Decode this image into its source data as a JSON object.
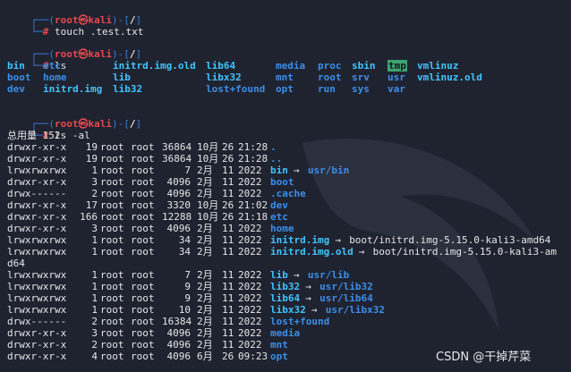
{
  "prompt": {
    "top": "┌──(",
    "user": "root",
    "at": "㉿",
    "host": "kali",
    "mid": ")-[",
    "path": "/",
    "end": "]",
    "bottom": "└─",
    "hash": "# "
  },
  "commands": {
    "cmd1": "touch .test.txt",
    "cmd2": "ls",
    "cmd3": "ls -al"
  },
  "ls_rows": [
    [
      "bin",
      "etc",
      "initrd.img.old",
      "lib64",
      "media",
      "proc",
      "sbin",
      "tmp",
      "vmlinuz"
    ],
    [
      "boot",
      "home",
      "lib",
      "libx32",
      "mnt",
      "root",
      "srv",
      "usr",
      "vmlinuz.old"
    ],
    [
      "dev",
      "initrd.img",
      "lib32",
      "lost+found",
      "opt",
      "run",
      "sys",
      "var",
      ""
    ]
  ],
  "total_line": "总用量 152",
  "listing": [
    {
      "perm": "drwxr-xr-x",
      "links": "19",
      "user": "root",
      "group": "root",
      "size": "36864",
      "month": "10月",
      "day": "26",
      "time": "21:28",
      "name": ".",
      "target": ""
    },
    {
      "perm": "drwxr-xr-x",
      "links": "19",
      "user": "root",
      "group": "root",
      "size": "36864",
      "month": "10月",
      "day": "26",
      "time": "21:28",
      "name": "..",
      "target": ""
    },
    {
      "perm": "lrwxrwxrwx",
      "links": "1",
      "user": "root",
      "group": "root",
      "size": "7",
      "month": "2月",
      "day": "11",
      "time": "2022",
      "name": "bin",
      "target": "usr/bin"
    },
    {
      "perm": "drwxr-xr-x",
      "links": "3",
      "user": "root",
      "group": "root",
      "size": "4096",
      "month": "2月",
      "day": "11",
      "time": "2022",
      "name": "boot",
      "target": ""
    },
    {
      "perm": "drwx------",
      "links": "2",
      "user": "root",
      "group": "root",
      "size": "4096",
      "month": "2月",
      "day": "11",
      "time": "2022",
      "name": ".cache",
      "target": ""
    },
    {
      "perm": "drwxr-xr-x",
      "links": "17",
      "user": "root",
      "group": "root",
      "size": "3320",
      "month": "10月",
      "day": "26",
      "time": "21:02",
      "name": "dev",
      "target": ""
    },
    {
      "perm": "drwxr-xr-x",
      "links": "166",
      "user": "root",
      "group": "root",
      "size": "12288",
      "month": "10月",
      "day": "26",
      "time": "21:18",
      "name": "etc",
      "target": ""
    },
    {
      "perm": "drwxr-xr-x",
      "links": "3",
      "user": "root",
      "group": "root",
      "size": "4096",
      "month": "2月",
      "day": "11",
      "time": "2022",
      "name": "home",
      "target": ""
    },
    {
      "perm": "lrwxrwxrwx",
      "links": "1",
      "user": "root",
      "group": "root",
      "size": "34",
      "month": "2月",
      "day": "11",
      "time": "2022",
      "name": "initrd.img",
      "target": "boot/initrd.img-5.15.0-kali3-amd64"
    },
    {
      "perm": "lrwxrwxrwx",
      "links": "1",
      "user": "root",
      "group": "root",
      "size": "34",
      "month": "2月",
      "day": "11",
      "time": "2022",
      "name": "initrd.img.old",
      "target": "boot/initrd.img-5.15.0-kali3-am"
    },
    {
      "perm": "lrwxrwxrwx",
      "links": "1",
      "user": "root",
      "group": "root",
      "size": "7",
      "month": "2月",
      "day": "11",
      "time": "2022",
      "name": "lib",
      "target": "usr/lib"
    },
    {
      "perm": "lrwxrwxrwx",
      "links": "1",
      "user": "root",
      "group": "root",
      "size": "9",
      "month": "2月",
      "day": "11",
      "time": "2022",
      "name": "lib32",
      "target": "usr/lib32"
    },
    {
      "perm": "lrwxrwxrwx",
      "links": "1",
      "user": "root",
      "group": "root",
      "size": "9",
      "month": "2月",
      "day": "11",
      "time": "2022",
      "name": "lib64",
      "target": "usr/lib64"
    },
    {
      "perm": "lrwxrwxrwx",
      "links": "1",
      "user": "root",
      "group": "root",
      "size": "10",
      "month": "2月",
      "day": "11",
      "time": "2022",
      "name": "libx32",
      "target": "usr/libx32"
    },
    {
      "perm": "drwx------",
      "links": "2",
      "user": "root",
      "group": "root",
      "size": "16384",
      "month": "2月",
      "day": "11",
      "time": "2022",
      "name": "lost+found",
      "target": ""
    },
    {
      "perm": "drwxr-xr-x",
      "links": "3",
      "user": "root",
      "group": "root",
      "size": "4096",
      "month": "2月",
      "day": "11",
      "time": "2022",
      "name": "media",
      "target": ""
    },
    {
      "perm": "drwxr-xr-x",
      "links": "2",
      "user": "root",
      "group": "root",
      "size": "4096",
      "month": "2月",
      "day": "11",
      "time": "2022",
      "name": "mnt",
      "target": ""
    },
    {
      "perm": "drwxr-xr-x",
      "links": "4",
      "user": "root",
      "group": "root",
      "size": "4096",
      "month": "6月",
      "day": "26",
      "time": "09:23",
      "name": "opt",
      "target": ""
    }
  ],
  "wrap_tail": "d64",
  "arrow": "→",
  "watermark": "CSDN @干掉芹菜",
  "colors": {
    "background": "#1f2330",
    "prompt_bracket": "#3a7bd5",
    "prompt_user": "#e5484d",
    "directory": "#3b8eea",
    "symlink": "#40c4ff",
    "tmp_highlight": "#3ca370"
  }
}
